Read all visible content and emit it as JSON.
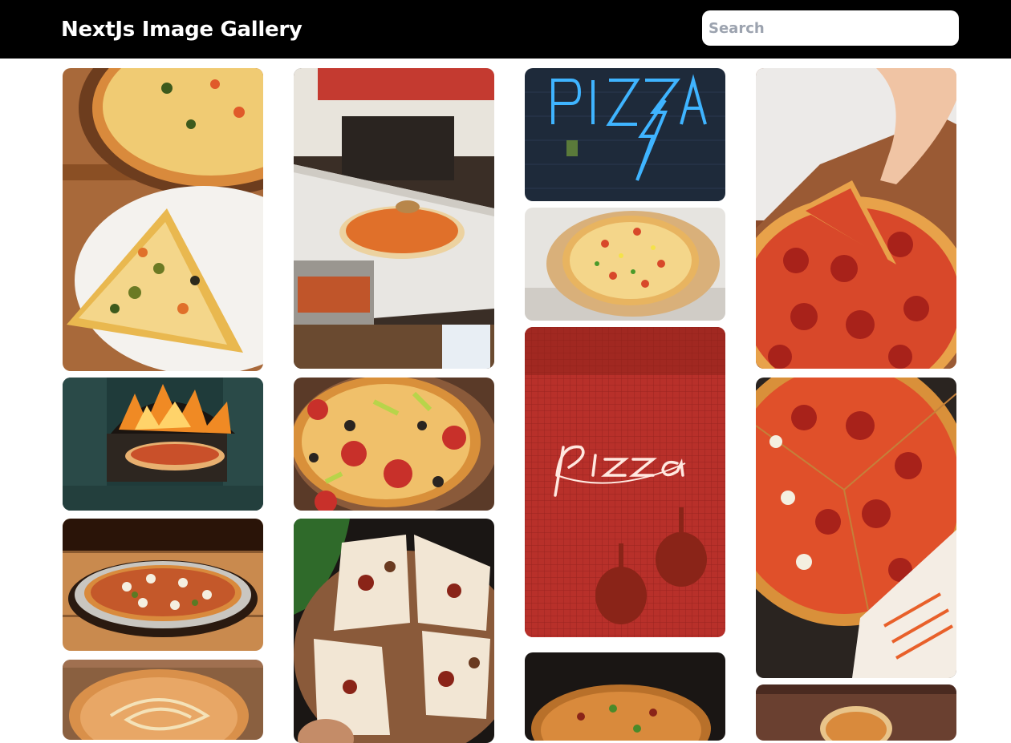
{
  "header": {
    "title": "NextJs Image Gallery",
    "search_placeholder": "Search"
  },
  "colors": {
    "header_bg": "#000000",
    "page_bg": "#ffffff"
  },
  "gallery": {
    "images": [
      {
        "name": "pizza-slice-on-plate"
      },
      {
        "name": "wood-fired-oven-pizza"
      },
      {
        "name": "egg-topped-pizza"
      },
      {
        "name": "pizza-with-sauce-swirl"
      },
      {
        "name": "chef-spreading-sauce"
      },
      {
        "name": "tomato-olive-pizza"
      },
      {
        "name": "sliced-pizza-on-board"
      },
      {
        "name": "blue-neon-pizza-sign"
      },
      {
        "name": "pizza-on-wooden-board"
      },
      {
        "name": "red-neon-pizza-sign"
      },
      {
        "name": "dark-pizza-topdown"
      },
      {
        "name": "hand-lifting-pepperoni-slice"
      },
      {
        "name": "pepperoni-pizza-with-paper"
      },
      {
        "name": "pizza-on-wooden-table"
      }
    ]
  }
}
